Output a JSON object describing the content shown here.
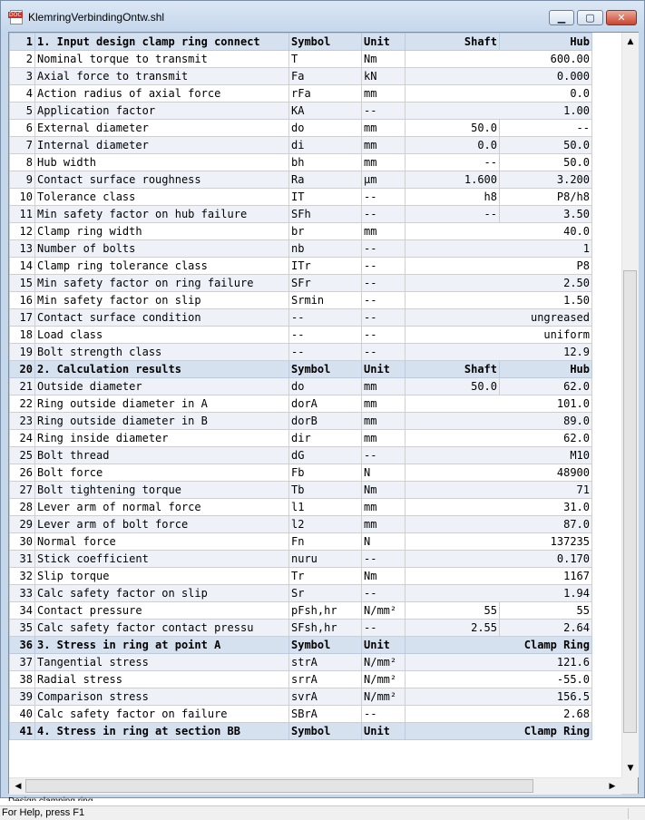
{
  "window": {
    "title": "KlemringVerbindingOntw.shl",
    "icon_tag": "DOC"
  },
  "rows": [
    {
      "n": "1",
      "type": "header",
      "desc": "1. Input design clamp ring connect",
      "sym": "Symbol",
      "unit": "Unit",
      "shaft": "Shaft",
      "hub": "Hub"
    },
    {
      "n": "2",
      "desc": "Nominal torque to transmit",
      "sym": "T",
      "unit": "Nm",
      "value": "600.00"
    },
    {
      "n": "3",
      "desc": "Axial force to transmit",
      "sym": "Fa",
      "unit": "kN",
      "value": "0.000"
    },
    {
      "n": "4",
      "desc": "Action radius of axial force",
      "sym": "rFa",
      "unit": "mm",
      "value": "0.0"
    },
    {
      "n": "5",
      "desc": "Application factor",
      "sym": "KA",
      "unit": "--",
      "value": "1.00"
    },
    {
      "n": "6",
      "desc": "External diameter",
      "sym": "do",
      "unit": "mm",
      "shaft": "50.0",
      "hub": "--"
    },
    {
      "n": "7",
      "desc": "Internal diameter",
      "sym": "di",
      "unit": "mm",
      "shaft": "0.0",
      "hub": "50.0"
    },
    {
      "n": "8",
      "desc": "Hub width",
      "sym": "bh",
      "unit": "mm",
      "shaft": "--",
      "hub": "50.0"
    },
    {
      "n": "9",
      "desc": "Contact surface roughness",
      "sym": "Ra",
      "unit": "µm",
      "shaft": "1.600",
      "hub": "3.200"
    },
    {
      "n": "10",
      "desc": "Tolerance class",
      "sym": "IT",
      "unit": "--",
      "shaft": "h8",
      "hub": "P8/h8"
    },
    {
      "n": "11",
      "desc": "Min safety factor on hub failure",
      "sym": "SFh",
      "unit": "--",
      "shaft": "--",
      "hub": "3.50"
    },
    {
      "n": "12",
      "desc": "Clamp ring width",
      "sym": "br",
      "unit": "mm",
      "value": "40.0"
    },
    {
      "n": "13",
      "desc": "Number of bolts",
      "sym": "nb",
      "unit": "--",
      "value": "1"
    },
    {
      "n": "14",
      "desc": "Clamp ring tolerance class",
      "sym": "ITr",
      "unit": "--",
      "value": "P8"
    },
    {
      "n": "15",
      "desc": "Min safety factor on ring failure",
      "sym": "SFr",
      "unit": "--",
      "value": "2.50"
    },
    {
      "n": "16",
      "desc": "Min safety factor on slip",
      "sym": "Srmin",
      "unit": "--",
      "value": "1.50"
    },
    {
      "n": "17",
      "desc": "Contact surface condition",
      "sym": "--",
      "unit": "--",
      "value": "ungreased"
    },
    {
      "n": "18",
      "desc": "Load class",
      "sym": "--",
      "unit": "--",
      "value": "uniform"
    },
    {
      "n": "19",
      "desc": "Bolt strength class",
      "sym": "--",
      "unit": "--",
      "value": "12.9"
    },
    {
      "n": "20",
      "type": "header",
      "desc": "2. Calculation results",
      "sym": "Symbol",
      "unit": "Unit",
      "shaft": "Shaft",
      "hub": "Hub"
    },
    {
      "n": "21",
      "desc": "Outside diameter",
      "sym": "do",
      "unit": "mm",
      "shaft": "50.0",
      "hub": "62.0"
    },
    {
      "n": "22",
      "desc": "Ring outside diameter in A",
      "sym": "dorA",
      "unit": "mm",
      "value": "101.0"
    },
    {
      "n": "23",
      "desc": "Ring outside diameter in B",
      "sym": "dorB",
      "unit": "mm",
      "value": "89.0"
    },
    {
      "n": "24",
      "desc": "Ring inside diameter",
      "sym": "dir",
      "unit": "mm",
      "value": "62.0"
    },
    {
      "n": "25",
      "desc": "Bolt thread",
      "sym": "dG",
      "unit": "--",
      "value": "M10"
    },
    {
      "n": "26",
      "desc": "Bolt force",
      "sym": "Fb",
      "unit": "N",
      "value": "48900"
    },
    {
      "n": "27",
      "desc": "Bolt tightening torque",
      "sym": "Tb",
      "unit": "Nm",
      "value": "71"
    },
    {
      "n": "28",
      "desc": "Lever arm of normal force",
      "sym": "l1",
      "unit": "mm",
      "value": "31.0"
    },
    {
      "n": "29",
      "desc": "Lever arm of bolt force",
      "sym": "l2",
      "unit": "mm",
      "value": "87.0"
    },
    {
      "n": "30",
      "desc": "Normal force",
      "sym": "Fn",
      "unit": "N",
      "value": "137235"
    },
    {
      "n": "31",
      "desc": "Stick coefficient",
      "sym": "nuru",
      "unit": "--",
      "value": "0.170"
    },
    {
      "n": "32",
      "desc": "Slip torque",
      "sym": "Tr",
      "unit": "Nm",
      "value": "1167"
    },
    {
      "n": "33",
      "desc": "Calc safety factor on slip",
      "sym": "Sr",
      "unit": "--",
      "value": "1.94"
    },
    {
      "n": "34",
      "desc": "Contact pressure",
      "sym": "pFsh,hr",
      "unit": "N/mm²",
      "shaft": "55",
      "hub": "55"
    },
    {
      "n": "35",
      "desc": "Calc safety factor contact pressu",
      "sym": "SFsh,hr",
      "unit": "--",
      "shaft": "2.55",
      "hub": "2.64"
    },
    {
      "n": "36",
      "type": "header",
      "desc": "3. Stress in ring at point A",
      "sym": "Symbol",
      "unit": "Unit",
      "value": "Clamp Ring"
    },
    {
      "n": "37",
      "desc": "Tangential stress",
      "sym": "strA",
      "unit": "N/mm²",
      "value": "121.6"
    },
    {
      "n": "38",
      "desc": "Radial stress",
      "sym": "srrA",
      "unit": "N/mm²",
      "value": "-55.0"
    },
    {
      "n": "39",
      "desc": "Comparison stress",
      "sym": "svrA",
      "unit": "N/mm²",
      "value": "156.5"
    },
    {
      "n": "40",
      "desc": "Calc safety factor on failure",
      "sym": "SBrA",
      "unit": "--",
      "value": "2.68"
    },
    {
      "n": "41",
      "type": "header",
      "desc": "4. Stress in ring at section BB",
      "sym": "Symbol",
      "unit": "Unit",
      "value": "Clamp Ring"
    }
  ],
  "sheet_tab": "Design clamping ring",
  "status": {
    "text": "For Help, press F1"
  }
}
